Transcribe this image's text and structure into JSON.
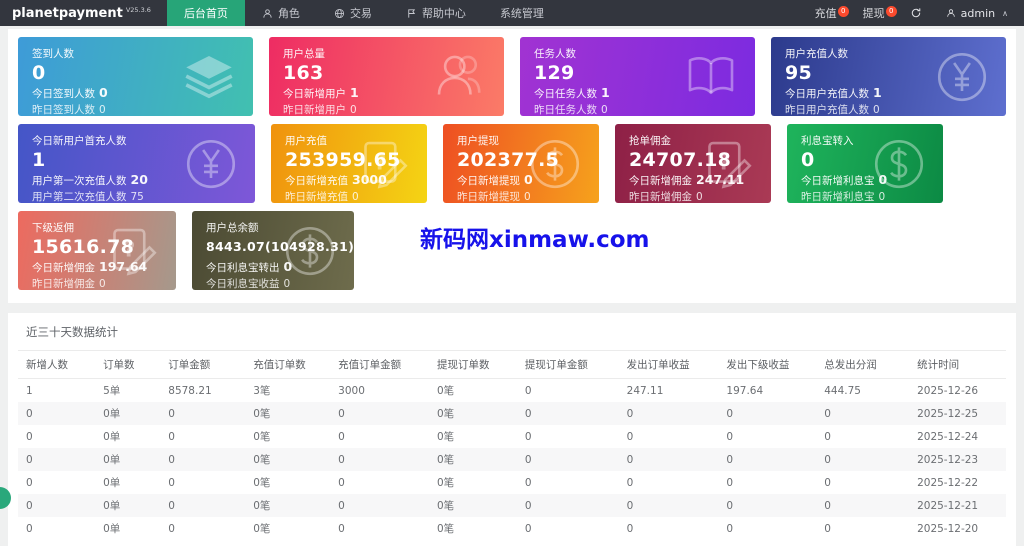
{
  "topbar": {
    "logo": "planetpayment",
    "version": "V25.3.6",
    "nav": [
      {
        "label": "后台首页",
        "icon": null,
        "active": true
      },
      {
        "label": "角色",
        "icon": "person",
        "active": false
      },
      {
        "label": "交易",
        "icon": "globe",
        "active": false
      },
      {
        "label": "帮助中心",
        "icon": "flag",
        "active": false
      },
      {
        "label": "系统管理",
        "icon": null,
        "active": false
      }
    ],
    "recharge": {
      "label": "充值",
      "badge": "0"
    },
    "withdraw": {
      "label": "提现",
      "badge": "0"
    },
    "user": "admin"
  },
  "card_rows": [
    [
      {
        "title": "签到人数",
        "value": "0",
        "icon": "layers",
        "colors": [
          "#3e9bd8",
          "#41c0b0"
        ],
        "lines": [
          {
            "label": "今日签到人数",
            "value": "0"
          },
          {
            "label": "昨日签到人数",
            "value": "0"
          }
        ]
      },
      {
        "title": "用户总量",
        "value": "163",
        "icon": "users",
        "colors": [
          "#ee2c63",
          "#fb7b67"
        ],
        "lines": [
          {
            "label": "今日新增用户",
            "value": "1"
          },
          {
            "label": "昨日新增用户",
            "value": "0"
          }
        ]
      },
      {
        "title": "任务人数",
        "value": "129",
        "icon": "book",
        "colors": [
          "#a133d2",
          "#7c2be0"
        ],
        "lines": [
          {
            "label": "今日任务人数",
            "value": "1"
          },
          {
            "label": "昨日任务人数",
            "value": "0"
          }
        ]
      },
      {
        "title": "用户充值人数",
        "value": "95",
        "icon": "yen",
        "colors": [
          "#2c3a8c",
          "#5e6fcf"
        ],
        "lines": [
          {
            "label": "今日用户充值人数",
            "value": "1"
          },
          {
            "label": "昨日用户充值人数",
            "value": "0"
          }
        ]
      }
    ],
    [
      {
        "title": "今日新用户首充人数",
        "value": "1",
        "icon": "yen",
        "colors": [
          "#4456c7",
          "#7e57d8"
        ],
        "lines": [
          {
            "label": "用户第一次充值人数",
            "value": "20"
          },
          {
            "label": "用户第二次充值人数",
            "value": "75"
          }
        ]
      },
      {
        "title": "用户充值",
        "value": "253959.65",
        "icon": "form",
        "colors": [
          "#f0920e",
          "#f4d414"
        ],
        "lines": [
          {
            "label": "今日新增充值",
            "value": "3000"
          },
          {
            "label": "昨日新增充值",
            "value": "0"
          }
        ]
      },
      {
        "title": "用户提现",
        "value": "202377.5",
        "icon": "dollar",
        "colors": [
          "#ee4f23",
          "#f6a21c"
        ],
        "lines": [
          {
            "label": "今日新增提现",
            "value": "0"
          },
          {
            "label": "昨日新增提现",
            "value": "0"
          }
        ]
      },
      {
        "title": "抢单佣金",
        "value": "24707.18",
        "icon": "form",
        "colors": [
          "#8e2046",
          "#aa3a55"
        ],
        "lines": [
          {
            "label": "今日新增佣金",
            "value": "247.11"
          },
          {
            "label": "昨日新增佣金",
            "value": "0"
          }
        ]
      },
      {
        "title": "利息宝转入",
        "value": "0",
        "icon": "dollar",
        "colors": [
          "#1fb45c",
          "#0c8a44"
        ],
        "lines": [
          {
            "label": "今日新增利息宝",
            "value": "0"
          },
          {
            "label": "昨日新增利息宝",
            "value": "0"
          }
        ]
      }
    ],
    [
      {
        "title": "下级返佣",
        "value": "15616.78",
        "icon": "form",
        "colors": [
          "#ed6a5f",
          "#a5998c"
        ],
        "lines": [
          {
            "label": "今日新增佣金",
            "value": "197.64"
          },
          {
            "label": "昨日新增佣金",
            "value": "0"
          }
        ]
      },
      {
        "title": "用户总余额",
        "value": "8443.07(104928.31)",
        "icon": "dollar",
        "colors": [
          "#4b4a33",
          "#6e6c4c"
        ],
        "lines": [
          {
            "label": "今日利息宝转出",
            "value": "0"
          },
          {
            "label": "今日利息宝收益",
            "value": "0"
          }
        ]
      }
    ]
  ],
  "watermark": "新码网xinmaw.com",
  "table": {
    "title": "近三十天数据统计",
    "columns": [
      "新增人数",
      "订单数",
      "订单金额",
      "充值订单数",
      "充值订单金额",
      "提现订单数",
      "提现订单金额",
      "发出订单收益",
      "发出下级收益",
      "总发出分润",
      "统计时间"
    ],
    "rows": [
      [
        "1",
        "5单",
        "8578.21",
        "3笔",
        "3000",
        "0笔",
        "0",
        "247.11",
        "197.64",
        "444.75",
        "2025-12-26"
      ],
      [
        "0",
        "0单",
        "0",
        "0笔",
        "0",
        "0笔",
        "0",
        "0",
        "0",
        "0",
        "2025-12-25"
      ],
      [
        "0",
        "0单",
        "0",
        "0笔",
        "0",
        "0笔",
        "0",
        "0",
        "0",
        "0",
        "2025-12-24"
      ],
      [
        "0",
        "0单",
        "0",
        "0笔",
        "0",
        "0笔",
        "0",
        "0",
        "0",
        "0",
        "2025-12-23"
      ],
      [
        "0",
        "0单",
        "0",
        "0笔",
        "0",
        "0笔",
        "0",
        "0",
        "0",
        "0",
        "2025-12-22"
      ],
      [
        "0",
        "0单",
        "0",
        "0笔",
        "0",
        "0笔",
        "0",
        "0",
        "0",
        "0",
        "2025-12-21"
      ],
      [
        "0",
        "0单",
        "0",
        "0笔",
        "0",
        "0笔",
        "0",
        "0",
        "0",
        "0",
        "2025-12-20"
      ]
    ]
  }
}
